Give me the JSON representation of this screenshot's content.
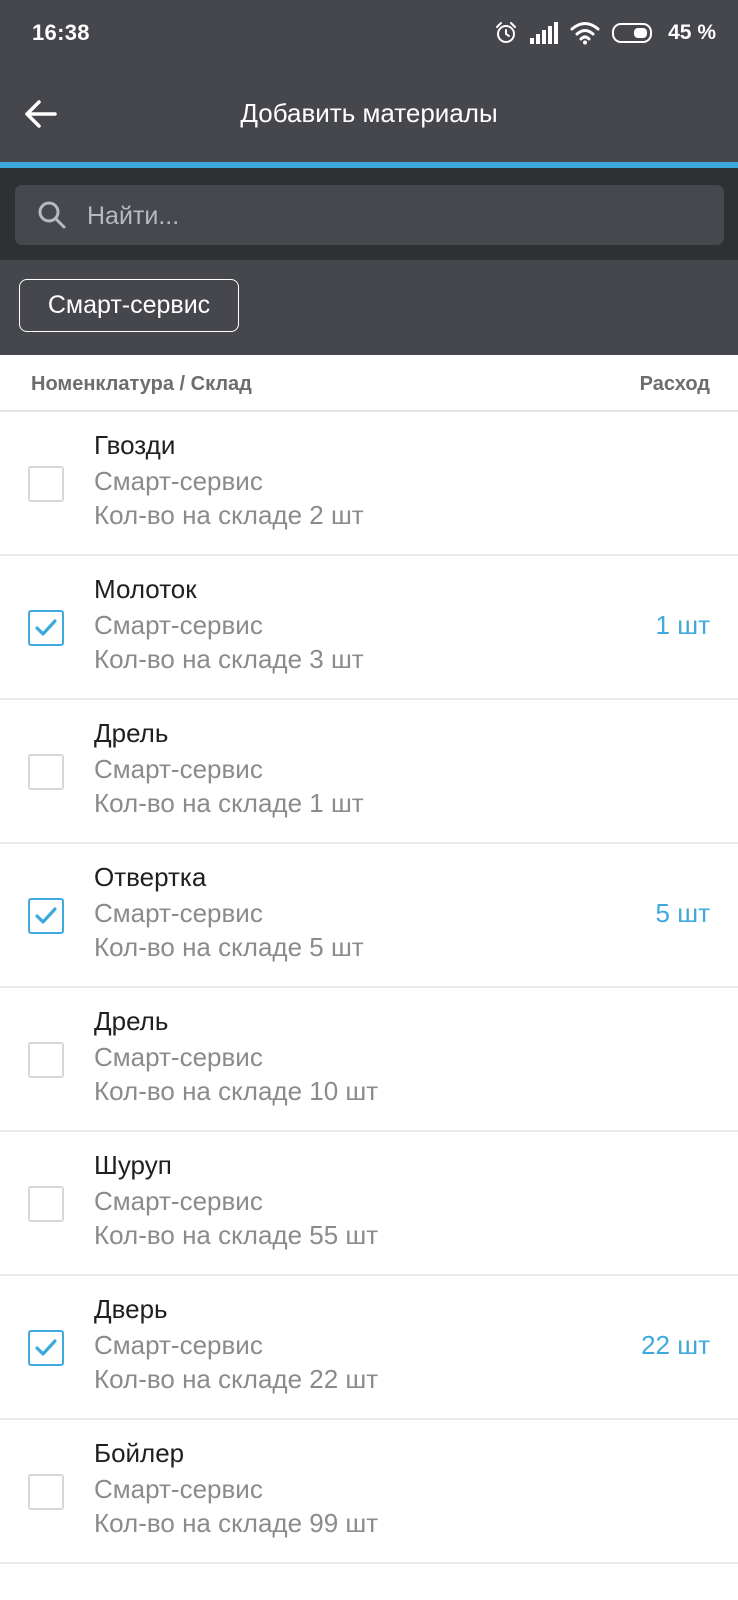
{
  "status": {
    "time": "16:38",
    "battery": "45 %"
  },
  "header": {
    "title": "Добавить материалы"
  },
  "search": {
    "placeholder": "Найти...",
    "value": ""
  },
  "filter": {
    "chip_label": "Смарт-сервис"
  },
  "table": {
    "col_left": "Номенклатура / Склад",
    "col_right": "Расход"
  },
  "colors": {
    "app_bar": "#45474c",
    "accent": "#3fa9dd"
  },
  "items": [
    {
      "name": "Гвозди",
      "warehouse": "Смарт-сервис",
      "stock": "Кол-во на складе 2 шт",
      "checked": false,
      "qty": ""
    },
    {
      "name": "Молоток",
      "warehouse": "Смарт-сервис",
      "stock": "Кол-во на складе 3 шт",
      "checked": true,
      "qty": "1 шт"
    },
    {
      "name": "Дрель",
      "warehouse": "Смарт-сервис",
      "stock": "Кол-во на складе 1 шт",
      "checked": false,
      "qty": ""
    },
    {
      "name": "Отвертка",
      "warehouse": "Смарт-сервис",
      "stock": "Кол-во на складе 5 шт",
      "checked": true,
      "qty": "5 шт"
    },
    {
      "name": "Дрель",
      "warehouse": "Смарт-сервис",
      "stock": "Кол-во на складе 10 шт",
      "checked": false,
      "qty": ""
    },
    {
      "name": "Шуруп",
      "warehouse": "Смарт-сервис",
      "stock": "Кол-во на складе 55 шт",
      "checked": false,
      "qty": ""
    },
    {
      "name": "Дверь",
      "warehouse": "Смарт-сервис",
      "stock": "Кол-во на складе 22 шт",
      "checked": true,
      "qty": "22 шт"
    },
    {
      "name": "Бойлер",
      "warehouse": "Смарт-сервис",
      "stock": "Кол-во на складе 99 шт",
      "checked": false,
      "qty": ""
    }
  ]
}
